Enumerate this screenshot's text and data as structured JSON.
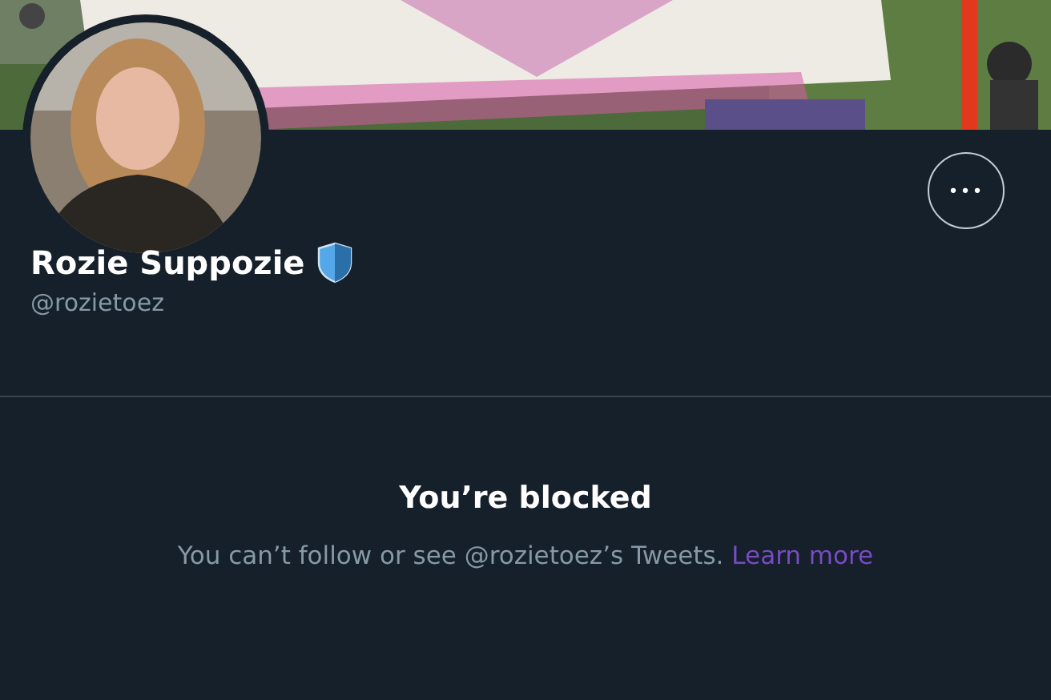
{
  "profile": {
    "name": "Rozie Suppozie",
    "handle": "@rozietoez"
  },
  "more_button": {
    "label": "•••"
  },
  "blocked": {
    "title": "You’re blocked",
    "message": "You can’t follow or see @rozietoez’s Tweets.",
    "link": "Learn more"
  }
}
